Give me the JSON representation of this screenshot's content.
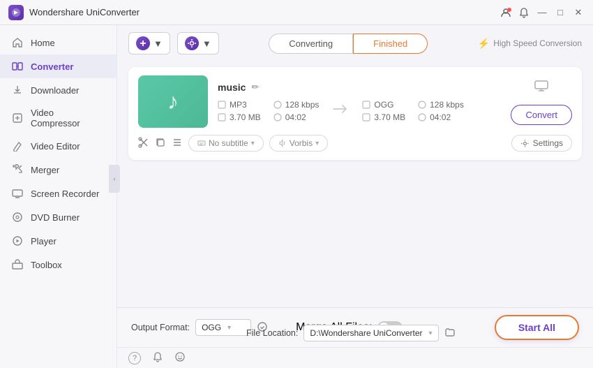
{
  "app": {
    "title": "Wondershare UniConverter",
    "logo_char": "W"
  },
  "titlebar": {
    "user_icon": "👤",
    "bell_icon": "🔔",
    "minimize": "—",
    "maximize": "□",
    "close": "✕"
  },
  "sidebar": {
    "items": [
      {
        "id": "home",
        "label": "Home",
        "icon": "⌂"
      },
      {
        "id": "converter",
        "label": "Converter",
        "icon": "⟳",
        "active": true
      },
      {
        "id": "downloader",
        "label": "Downloader",
        "icon": "↓"
      },
      {
        "id": "video-compressor",
        "label": "Video Compressor",
        "icon": "⊡"
      },
      {
        "id": "video-editor",
        "label": "Video Editor",
        "icon": "✏"
      },
      {
        "id": "merger",
        "label": "Merger",
        "icon": "⊞"
      },
      {
        "id": "screen-recorder",
        "label": "Screen Recorder",
        "icon": "▣"
      },
      {
        "id": "dvd-burner",
        "label": "DVD Burner",
        "icon": "⊙"
      },
      {
        "id": "player",
        "label": "Player",
        "icon": "▶"
      },
      {
        "id": "toolbox",
        "label": "Toolbox",
        "icon": "⊞"
      }
    ]
  },
  "toolbar": {
    "add_files_label": "Add Files",
    "add_btn_icon": "+",
    "settings_btn_icon": "⚙"
  },
  "tabs": {
    "converting_label": "Converting",
    "finished_label": "Finished",
    "active": "Finished"
  },
  "high_speed": {
    "label": "High Speed Conversion",
    "icon": "⚡"
  },
  "file": {
    "name": "music",
    "thumbnail_icon": "♪",
    "source": {
      "format": "MP3",
      "size": "3.70 MB",
      "bitrate": "128 kbps",
      "duration": "04:02"
    },
    "target": {
      "format": "OGG",
      "size": "3.70 MB",
      "bitrate": "128 kbps",
      "duration": "04:02"
    },
    "convert_btn_label": "Convert",
    "subtitle_placeholder": "No subtitle",
    "audio_placeholder": "Vorbis",
    "settings_label": "Settings"
  },
  "bottom_bar": {
    "output_format_label": "Output Format:",
    "output_format_value": "OGG",
    "file_location_label": "File Location:",
    "file_location_value": "D:\\Wondershare UniConverter",
    "merge_all_label": "Merge All Files:",
    "start_all_label": "Start All"
  },
  "status_bar": {
    "help_icon": "?",
    "bell_icon": "🔔",
    "feedback_icon": "☺"
  }
}
